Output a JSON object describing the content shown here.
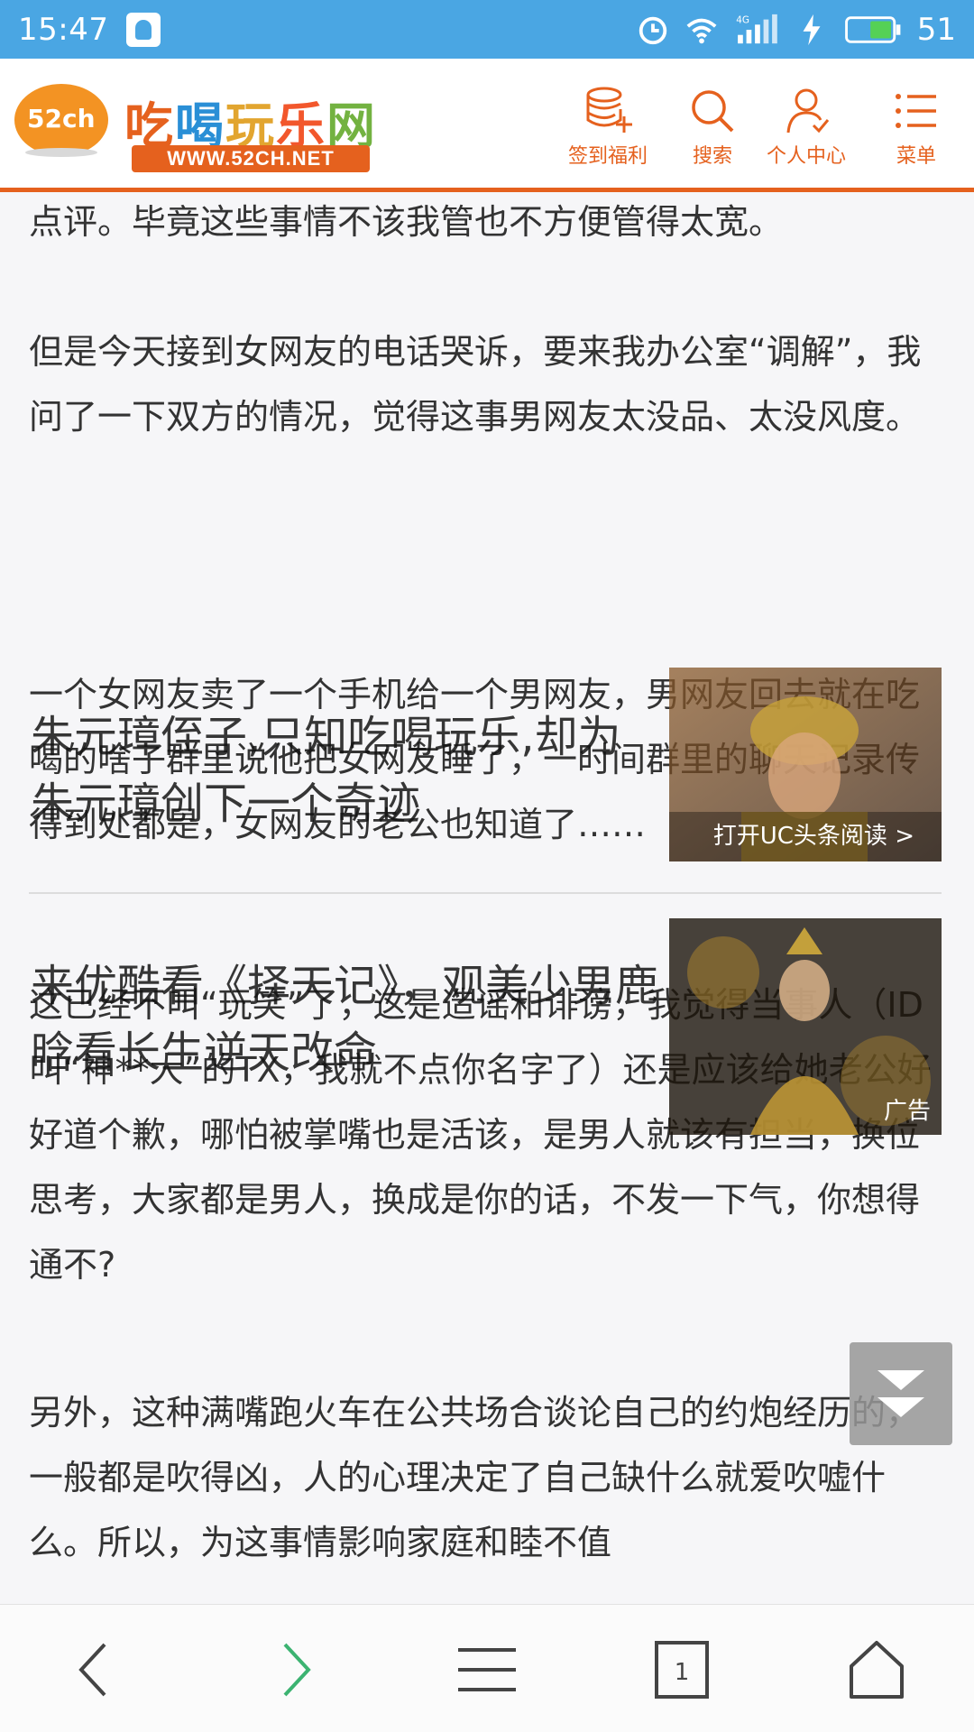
{
  "status_bar": {
    "time": "15:47",
    "battery": "51",
    "icons": [
      "notification-icon",
      "alarm-icon",
      "wifi-icon",
      "signal-4g-icon",
      "charging-icon",
      "battery-icon"
    ]
  },
  "header": {
    "logo_badge": "52ch",
    "logo_name_chars": [
      "吃",
      "喝",
      "玩",
      "乐",
      "网"
    ],
    "logo_url": "WWW.52CH.NET",
    "nav": [
      {
        "label": "签到福利",
        "icon": "database-plus-icon"
      },
      {
        "label": "搜索",
        "icon": "search-icon"
      },
      {
        "label": "个人中心",
        "icon": "user-icon"
      },
      {
        "label": "菜单",
        "icon": "menu-icon"
      }
    ],
    "accent_color": "#e5611e"
  },
  "article": {
    "paragraphs": [
      "点评。毕竟这些事情不该我管也不方便管得太宽。",
      "但是今天接到女网友的电话哭诉，要来我办公室“调解”，我问了一下双方的情况，觉得这事男网友太没品、太没风度。",
      "一个女网友卖了一个手机给一个男网友，男网友回去就在吃喝的啥子群里说他把女网友睡了，一时间群里的聊天记录传得到处都是，女网友的老公也知道了……",
      "这已经不叫“玩笑”了，这是造谣和诽谤，我觉得当事人（ID叫“神**大”的TX，我就不点你名字了）还是应该给她老公好好道个歉，哪怕被掌嘴也是活该，是男人就该有担当，换位思考，大家都是男人，换成是你的话，不发一下气，你想得通不?",
      "另外，这种满嘴跑火车在公共场合谈论自己的约炮经历的，一般都是吹得凶，人的心理决定了自己缺什么就爱吹嘘什么。所以，为这事情影响家庭和睦不值"
    ]
  },
  "ads": [
    {
      "title": "朱元璋侄子,只知吃喝玩乐,却为朱元璋创下一个奇迹",
      "thumb_label": "打开UC头条阅读 >"
    },
    {
      "title": "来优酷看《择天记》，观美少男鹿晗看长生逆天改命",
      "thumb_tag": "广告"
    }
  ],
  "bottom_nav": [
    {
      "name": "back",
      "icon": "chevron-left-icon"
    },
    {
      "name": "forward",
      "icon": "chevron-right-icon",
      "color": "#3cb371"
    },
    {
      "name": "menu",
      "icon": "hamburger-icon"
    },
    {
      "name": "tabs",
      "icon": "tabs-icon",
      "count": "1"
    },
    {
      "name": "home",
      "icon": "home-icon"
    }
  ]
}
